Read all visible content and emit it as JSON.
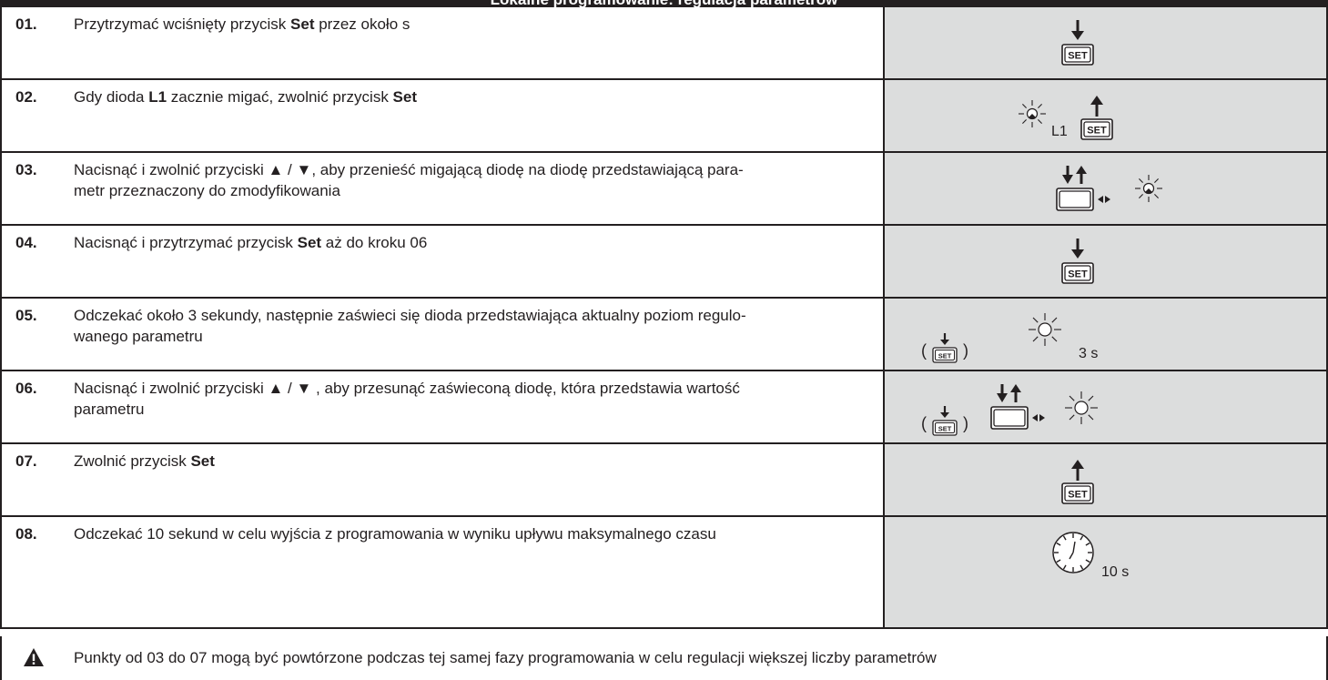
{
  "header": {
    "title": "Lokalne programowanie: regulacja parametrów"
  },
  "steps": [
    {
      "num": "01.",
      "parts": [
        "Przytrzymać wciśnięty przycisk ",
        "Set",
        " przez około s"
      ],
      "icons": [
        "set-press"
      ]
    },
    {
      "num": "02.",
      "parts": [
        "Gdy dioda ",
        "L1",
        " zacznie migać, zwolnić przycisk ",
        "Set"
      ],
      "icons": [
        "led-blink",
        "set-release"
      ],
      "led_label": "L1"
    },
    {
      "num": "03.",
      "parts": [
        "Nacisnąć i zwolnić przyciski ▲ / ▼, aby przenieść migającą diodę na diodę przedstawiającą para-",
        "metr przeznaczony do zmodyfikowania"
      ],
      "icons": [
        "updown-button",
        "led-blink"
      ]
    },
    {
      "num": "04.",
      "parts": [
        "Nacisnąć i przytrzymać przycisk ",
        "Set",
        " aż do kroku 06"
      ],
      "icons": [
        "set-press"
      ]
    },
    {
      "num": "05.",
      "parts": [
        "Odczekać około 3 sekundy, następnie zaświeci się dioda przedstawiająca aktualny poziom regulo-",
        "wanego parametru"
      ],
      "icons": [
        "set-press-small",
        "led-on"
      ],
      "time_label": "3 s"
    },
    {
      "num": "06.",
      "parts": [
        "Nacisnąć i zwolnić przyciski ▲ / ▼ , aby przesunąć zaświeconą diodę, która przedstawia wartość",
        "parametru"
      ],
      "icons": [
        "set-press-small",
        "updown-button",
        "led-on"
      ]
    },
    {
      "num": "07.",
      "parts": [
        "Zwolnić przycisk ",
        "Set"
      ],
      "icons": [
        "set-release"
      ]
    },
    {
      "num": "08.",
      "parts": [
        "Odczekać 10 sekund w celu wyjścia z programowania w wyniku upływu maksymalnego czasu"
      ],
      "icons": [
        "clock"
      ],
      "time_label": "10 s"
    }
  ],
  "icons": {
    "set_button_label": "SET",
    "open_paren": "(",
    "close_paren": ")"
  },
  "note": {
    "icon": "warning-triangle-icon",
    "text": "Punkty od 03 do 07 mogą być powtórzone podczas tej samej fazy programowania w celu regulacji większej liczby parametrów"
  },
  "colors": {
    "header_bg": "#231f20",
    "text": "#231f20",
    "icon_cell_bg": "#dcdddd",
    "row_bg": "#ffffff"
  }
}
